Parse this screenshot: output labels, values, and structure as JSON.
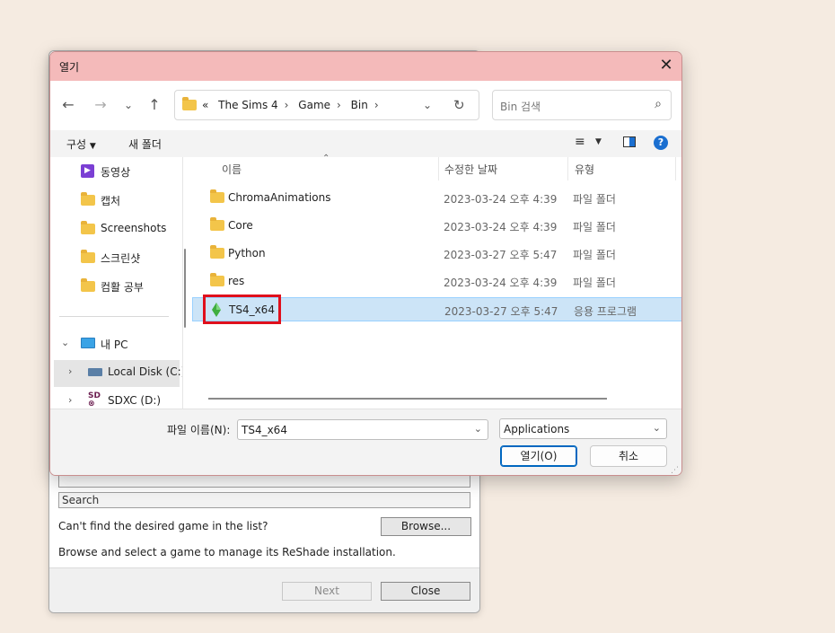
{
  "back_window": {
    "search_label": "Search",
    "prompt_text": "Can't find the desired game in the list?",
    "browse_label": "Browse...",
    "hint_text": "Browse and select a game to manage its ReShade installation.",
    "next_label": "Next",
    "close_label": "Close"
  },
  "dialog": {
    "title": "열기",
    "breadcrumb": [
      "The Sims 4",
      "Game",
      "Bin"
    ],
    "breadcrumb_overflow": "«",
    "search_placeholder": "Bin 검색",
    "toolbar": {
      "organize_label": "구성",
      "new_folder_label": "새 폴더"
    },
    "nav": {
      "items": [
        {
          "label": "동영상",
          "icon": "video-icon"
        },
        {
          "label": "캡처",
          "icon": "folder-icon"
        },
        {
          "label": "Screenshots",
          "icon": "folder-icon"
        },
        {
          "label": "스크린샷",
          "icon": "folder-icon"
        },
        {
          "label": "컴활 공부",
          "icon": "folder-icon"
        }
      ],
      "this_pc": "내 PC",
      "local_disk": "Local Disk (C:)",
      "sdxc": "SDXC (D:)"
    },
    "columns": {
      "name": "이름",
      "date": "수정한 날짜",
      "type": "유형"
    },
    "files": [
      {
        "name": "ChromaAnimations",
        "date": "2023-03-24 오후 4:39",
        "type": "파일 폴더"
      },
      {
        "name": "Core",
        "date": "2023-03-24 오후 4:39",
        "type": "파일 폴더"
      },
      {
        "name": "Python",
        "date": "2023-03-27 오후 5:47",
        "type": "파일 폴더"
      },
      {
        "name": "res",
        "date": "2023-03-24 오후 4:39",
        "type": "파일 폴더"
      },
      {
        "name": "TS4_x64",
        "date": "2023-03-27 오후 5:47",
        "type": "응용 프로그램"
      }
    ],
    "filename_label": "파일 이름(N):",
    "filename_value": "TS4_x64",
    "filetype_value": "Applications",
    "open_label": "열기(O)",
    "cancel_label": "취소"
  },
  "colors": {
    "titlebar": "#f4baba",
    "selection": "#cce4f7",
    "highlight_box": "#e0101c",
    "accent": "#0067c0"
  }
}
